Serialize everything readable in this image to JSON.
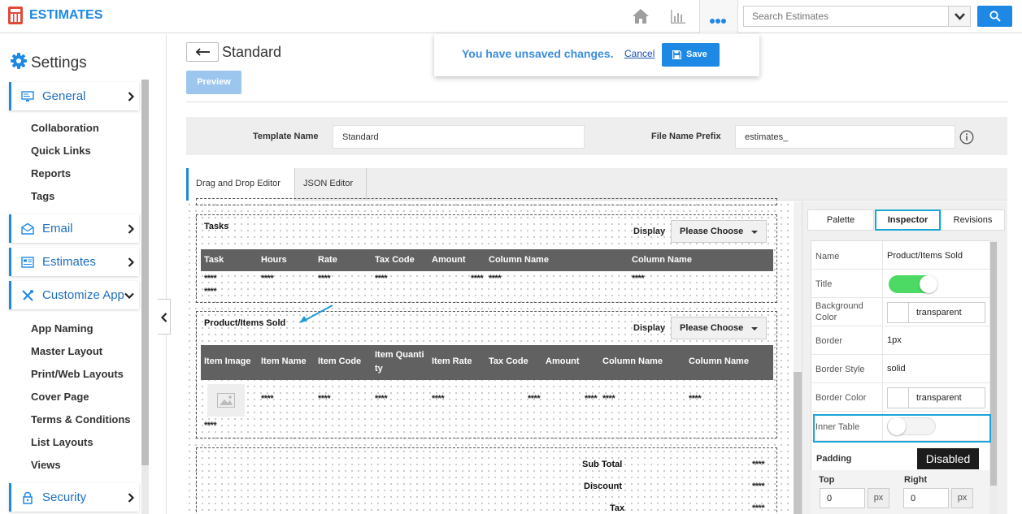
{
  "app": {
    "title": "ESTIMATES"
  },
  "search": {
    "placeholder": "Search Estimates"
  },
  "sidebar": {
    "title": "Settings",
    "items": [
      {
        "label": "General"
      },
      {
        "label": "Email"
      },
      {
        "label": "Estimates"
      },
      {
        "label": "Customize App"
      },
      {
        "label": "Security"
      }
    ],
    "general_sub": [
      "Collaboration",
      "Quick Links",
      "Reports",
      "Tags"
    ],
    "customize_sub": [
      "App Naming",
      "Master Layout",
      "Print/Web Layouts",
      "Cover Page",
      "Terms & Conditions",
      "List Layouts",
      "Views"
    ]
  },
  "page": {
    "title": "Standard",
    "preview_label": "Preview"
  },
  "unsaved": {
    "message": "You have unsaved changes.",
    "cancel_label": "Cancel",
    "save_label": "Save"
  },
  "template": {
    "name_label": "Template Name",
    "name_value": "Standard",
    "prefix_label": "File Name Prefix",
    "prefix_value": "estimates_"
  },
  "editor_tabs": [
    "Drag and Drop Editor",
    "JSON Editor"
  ],
  "canvas": {
    "display_label": "Display",
    "choose_label": "Please Choose",
    "tasks": {
      "title": "Tasks",
      "columns": [
        "Task",
        "Hours",
        "Rate",
        "Tax Code",
        "Amount",
        "Column Name",
        "Column Name"
      ],
      "placeholder": "****"
    },
    "products": {
      "title": "Product/Items Sold",
      "columns": [
        "Item Image",
        "Item Name",
        "Item Code",
        "Item Quanti",
        "ty",
        "Item Rate",
        "Tax Code",
        "Amount",
        "Column Name",
        "Column Name"
      ],
      "placeholder": "****"
    },
    "totals": [
      "Sub Total",
      "Discount",
      "Tax"
    ]
  },
  "inspector": {
    "tabs": [
      "Palette",
      "Inspector",
      "Revisions"
    ],
    "rows": {
      "name_label": "Name",
      "name_value": "Product/Items Sold",
      "title_label": "Title",
      "bg_label_1": "Background",
      "bg_label_2": "Color",
      "bg_value": "transparent",
      "border_label": "Border",
      "border_value": "1px",
      "border_style_label": "Border Style",
      "border_style_value": "solid",
      "border_color_label": "Border Color",
      "border_color_value": "transparent",
      "inner_table_label": "Inner Table"
    },
    "padding": {
      "title": "Padding",
      "top_label": "Top",
      "right_label": "Right",
      "top_value": "0",
      "right_value": "0",
      "unit": "px"
    },
    "tooltip": "Disabled"
  },
  "colors": {
    "accent": "#1e88e5",
    "toggle_on": "#4cd964",
    "highlight": "#1aa6d8",
    "table_header": "#616161"
  }
}
